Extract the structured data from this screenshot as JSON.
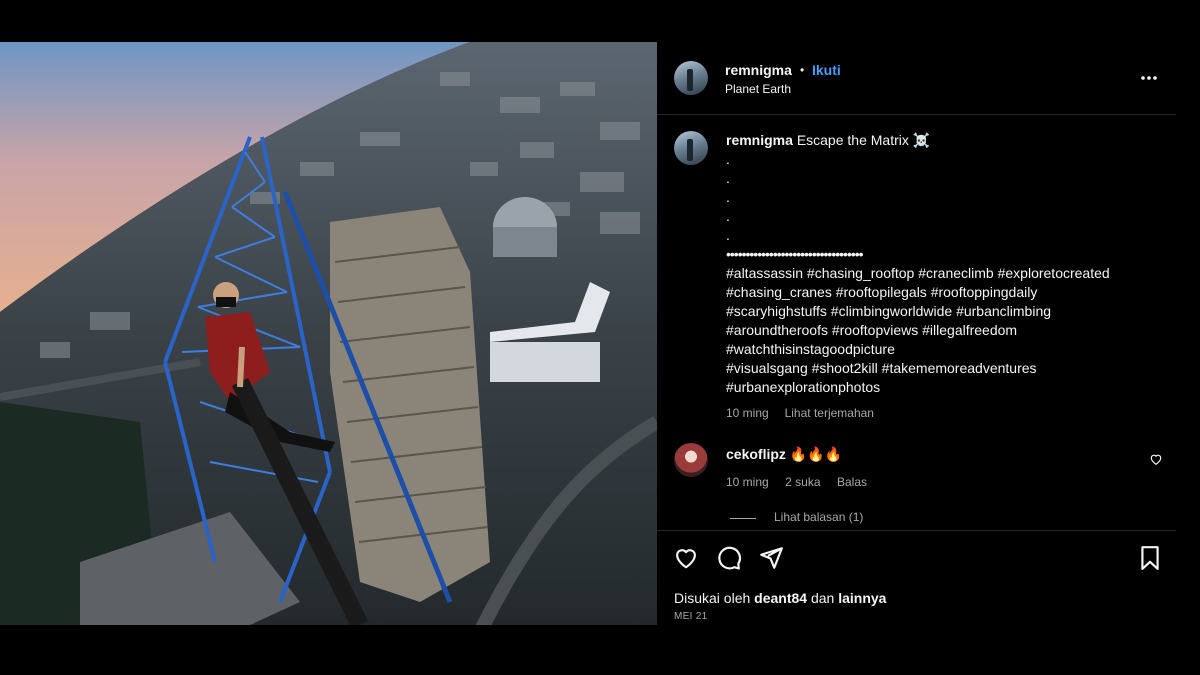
{
  "post": {
    "username": "remnigma",
    "separator": "•",
    "follow_label": "Ikuti",
    "location": "Planet Earth",
    "more_icon": "more-horizontal-icon"
  },
  "caption": {
    "username": "remnigma",
    "text": "Escape the Matrix ☠️",
    "dots": [
      ".",
      ".",
      ".",
      ".",
      "."
    ],
    "bullets": "•••••••••••••••••••••••••••••••••••",
    "hashtags": [
      "#altassassin #chasing_rooftop #craneclimb #exploretocreated",
      "#chasing_cranes #rooftopilegals #rooftoppingdaily",
      "#scaryhighstuffs #climbingworldwide #urbanclimbing",
      "#aroundtheroofs #rooftopviews #illegalfreedom",
      "#watchthisinstagoodpicture",
      "#visualsgang #shoot2kill #takememoreadventures",
      "#urbanexplorationphotos"
    ],
    "time": "10 ming",
    "translate_label": "Lihat terjemahan"
  },
  "comment": {
    "username": "cekoflipz",
    "text": "🔥🔥🔥",
    "time": "10 ming",
    "likes": "2 suka",
    "reply_label": "Balas",
    "view_replies_label": "Lihat balasan (1)"
  },
  "footer": {
    "liked_prefix": "Disukai oleh",
    "liked_user": "deant84",
    "liked_connector": "dan",
    "liked_suffix": "lainnya",
    "date": "MEI 21"
  },
  "colors": {
    "background": "#000000",
    "accent_blue": "#4a9df8",
    "muted": "#a8a8a8",
    "divider": "#262626"
  }
}
